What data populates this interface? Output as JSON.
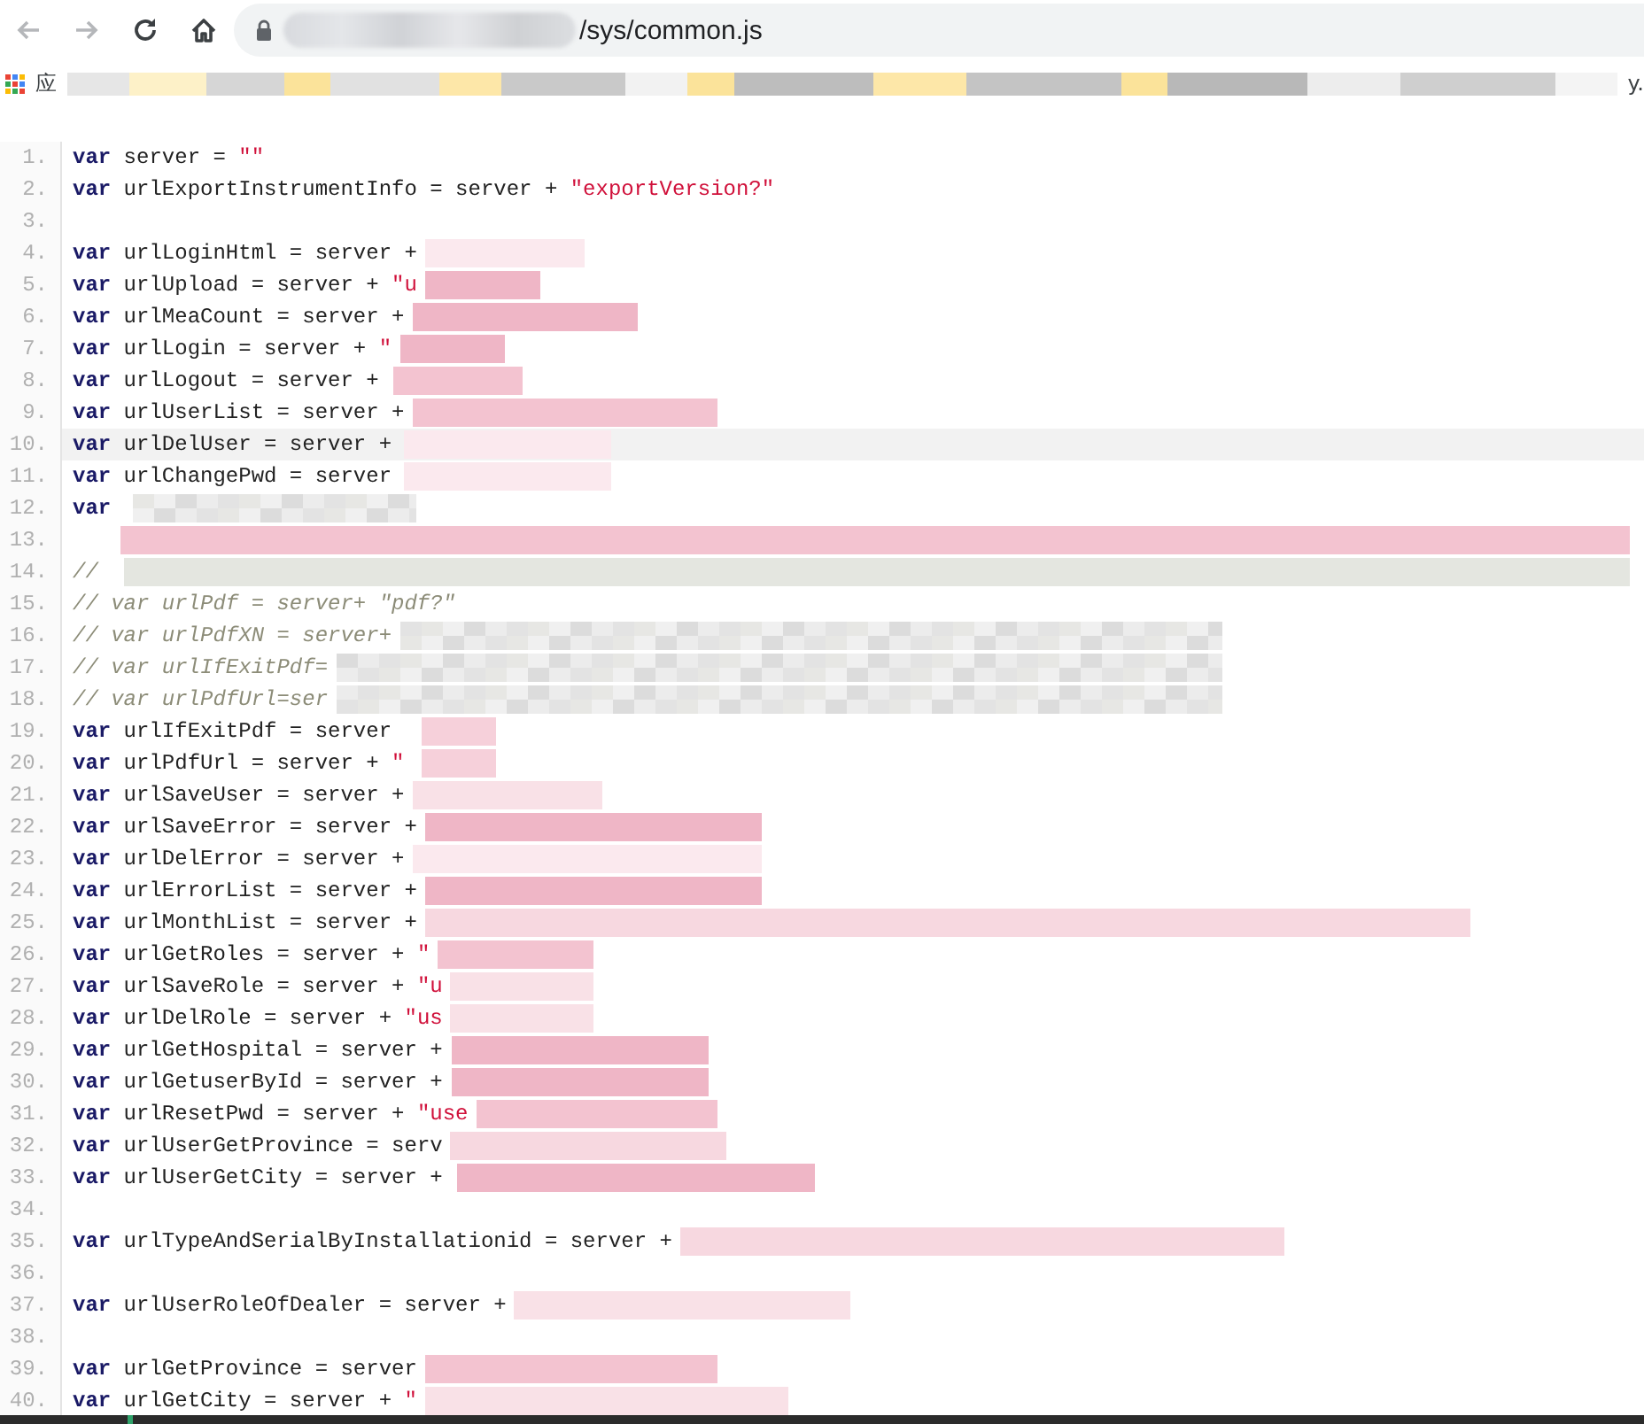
{
  "browser": {
    "nav_buttons": [
      {
        "kind": "back",
        "disabled": true
      },
      {
        "kind": "forward",
        "disabled": true
      },
      {
        "kind": "reload",
        "disabled": false
      },
      {
        "kind": "home",
        "disabled": false
      }
    ],
    "address": {
      "path": "/sys/common.js"
    },
    "bookmarks": [
      {
        "label": "应"
      },
      {
        "label": "y."
      }
    ]
  },
  "code": {
    "lines": [
      {
        "number": "1.",
        "current": false,
        "segments": [
          {
            "kind": "keyword",
            "text": "var"
          },
          {
            "kind": "plain",
            "text": " server = "
          },
          {
            "kind": "string",
            "text": "\"\""
          }
        ]
      },
      {
        "number": "2.",
        "current": false,
        "segments": [
          {
            "kind": "keyword",
            "text": "var"
          },
          {
            "kind": "plain",
            "text": " urlExportInstrumentInfo = server + "
          },
          {
            "kind": "string",
            "text": "\"exportVersion?\""
          }
        ]
      },
      {
        "number": "3.",
        "current": false
      },
      {
        "number": "4.",
        "current": false,
        "segments": [
          {
            "kind": "keyword",
            "text": "var"
          },
          {
            "kind": "plain",
            "text": " urlLoginHtml = server +"
          }
        ]
      },
      {
        "number": "5.",
        "current": false,
        "segments": [
          {
            "kind": "keyword",
            "text": "var"
          },
          {
            "kind": "plain",
            "text": " urlUpload = server + "
          },
          {
            "kind": "string",
            "text": "\"u"
          }
        ]
      },
      {
        "number": "6.",
        "current": false,
        "segments": [
          {
            "kind": "keyword",
            "text": "var"
          },
          {
            "kind": "plain",
            "text": " urlMeaCount = server +"
          }
        ]
      },
      {
        "number": "7.",
        "current": false,
        "segments": [
          {
            "kind": "keyword",
            "text": "var"
          },
          {
            "kind": "plain",
            "text": " urlLogin = server + "
          },
          {
            "kind": "string",
            "text": "\""
          }
        ]
      },
      {
        "number": "8.",
        "current": false,
        "segments": [
          {
            "kind": "keyword",
            "text": "var"
          },
          {
            "kind": "plain",
            "text": " urlLogout = server +"
          }
        ]
      },
      {
        "number": "9.",
        "current": false,
        "segments": [
          {
            "kind": "keyword",
            "text": "var"
          },
          {
            "kind": "plain",
            "text": " urlUserList = server +"
          }
        ]
      },
      {
        "number": "10.",
        "current": true,
        "segments": [
          {
            "kind": "keyword",
            "text": "var"
          },
          {
            "kind": "plain",
            "text": " urlDelUser = server +"
          }
        ]
      },
      {
        "number": "11.",
        "current": false,
        "segments": [
          {
            "kind": "keyword",
            "text": "var"
          },
          {
            "kind": "plain",
            "text": " urlChangePwd = server"
          }
        ]
      },
      {
        "number": "12.",
        "current": false,
        "segments": [
          {
            "kind": "keyword",
            "text": "var"
          }
        ]
      },
      {
        "number": "13.",
        "current": false
      },
      {
        "number": "14.",
        "current": false,
        "segments": [
          {
            "kind": "comment",
            "text": "//"
          }
        ]
      },
      {
        "number": "15.",
        "current": false,
        "segments": [
          {
            "kind": "comment",
            "text": "// var urlPdf = server+ \"pdf?\""
          }
        ]
      },
      {
        "number": "16.",
        "current": false,
        "segments": [
          {
            "kind": "comment",
            "text": "// var urlPdfXN = server+"
          }
        ]
      },
      {
        "number": "17.",
        "current": false,
        "segments": [
          {
            "kind": "comment",
            "text": "// var urlIfExitPdf="
          }
        ]
      },
      {
        "number": "18.",
        "current": false,
        "segments": [
          {
            "kind": "comment",
            "text": "// var urlPdfUrl=ser"
          }
        ]
      },
      {
        "number": "19.",
        "current": false,
        "segments": [
          {
            "kind": "keyword",
            "text": "var"
          },
          {
            "kind": "plain",
            "text": " urlIfExitPdf = server"
          }
        ]
      },
      {
        "number": "20.",
        "current": false,
        "segments": [
          {
            "kind": "keyword",
            "text": "var"
          },
          {
            "kind": "plain",
            "text": " urlPdfUrl = server + "
          },
          {
            "kind": "string",
            "text": "\""
          }
        ]
      },
      {
        "number": "21.",
        "current": false,
        "segments": [
          {
            "kind": "keyword",
            "text": "var"
          },
          {
            "kind": "plain",
            "text": " urlSaveUser = server +"
          }
        ]
      },
      {
        "number": "22.",
        "current": false,
        "segments": [
          {
            "kind": "keyword",
            "text": "var"
          },
          {
            "kind": "plain",
            "text": " urlSaveError = server +"
          }
        ]
      },
      {
        "number": "23.",
        "current": false,
        "segments": [
          {
            "kind": "keyword",
            "text": "var"
          },
          {
            "kind": "plain",
            "text": " urlDelError = server +"
          }
        ]
      },
      {
        "number": "24.",
        "current": false,
        "segments": [
          {
            "kind": "keyword",
            "text": "var"
          },
          {
            "kind": "plain",
            "text": " urlErrorList = server +"
          }
        ]
      },
      {
        "number": "25.",
        "current": false,
        "segments": [
          {
            "kind": "keyword",
            "text": "var"
          },
          {
            "kind": "plain",
            "text": " urlMonthList = server +"
          }
        ]
      },
      {
        "number": "26.",
        "current": false,
        "segments": [
          {
            "kind": "keyword",
            "text": "var"
          },
          {
            "kind": "plain",
            "text": " urlGetRoles = server + "
          },
          {
            "kind": "string",
            "text": "\""
          }
        ]
      },
      {
        "number": "27.",
        "current": false,
        "segments": [
          {
            "kind": "keyword",
            "text": "var"
          },
          {
            "kind": "plain",
            "text": " urlSaveRole = server + "
          },
          {
            "kind": "string",
            "text": "\"u"
          }
        ]
      },
      {
        "number": "28.",
        "current": false,
        "segments": [
          {
            "kind": "keyword",
            "text": "var"
          },
          {
            "kind": "plain",
            "text": " urlDelRole = server + "
          },
          {
            "kind": "string",
            "text": "\"us"
          }
        ]
      },
      {
        "number": "29.",
        "current": false,
        "segments": [
          {
            "kind": "keyword",
            "text": "var"
          },
          {
            "kind": "plain",
            "text": " urlGetHospital = server +"
          }
        ]
      },
      {
        "number": "30.",
        "current": false,
        "segments": [
          {
            "kind": "keyword",
            "text": "var"
          },
          {
            "kind": "plain",
            "text": " urlGetuserById = server +"
          }
        ]
      },
      {
        "number": "31.",
        "current": false,
        "segments": [
          {
            "kind": "keyword",
            "text": "var"
          },
          {
            "kind": "plain",
            "text": " urlResetPwd = server + "
          },
          {
            "kind": "string",
            "text": "\"use"
          }
        ]
      },
      {
        "number": "32.",
        "current": false,
        "segments": [
          {
            "kind": "keyword",
            "text": "var"
          },
          {
            "kind": "plain",
            "text": " urlUserGetProvince = serv"
          }
        ]
      },
      {
        "number": "33.",
        "current": false,
        "segments": [
          {
            "kind": "keyword",
            "text": "var"
          },
          {
            "kind": "plain",
            "text": " urlUserGetCity = server +"
          }
        ]
      },
      {
        "number": "34.",
        "current": false
      },
      {
        "number": "35.",
        "current": false,
        "segments": [
          {
            "kind": "keyword",
            "text": "var"
          },
          {
            "kind": "plain",
            "text": " urlTypeAndSerialByInstallationid = server +"
          }
        ]
      },
      {
        "number": "36.",
        "current": false
      },
      {
        "number": "37.",
        "current": false,
        "segments": [
          {
            "kind": "keyword",
            "text": "var"
          },
          {
            "kind": "plain",
            "text": " urlUserRoleOfDealer = server +"
          }
        ]
      },
      {
        "number": "38.",
        "current": false
      },
      {
        "number": "39.",
        "current": false,
        "segments": [
          {
            "kind": "keyword",
            "text": "var"
          },
          {
            "kind": "plain",
            "text": " urlGetProvince = server"
          }
        ]
      },
      {
        "number": "40.",
        "current": false,
        "segments": [
          {
            "kind": "keyword",
            "text": "var"
          },
          {
            "kind": "plain",
            "text": " urlGetCity = server + "
          },
          {
            "kind": "string",
            "text": "\""
          }
        ]
      }
    ]
  }
}
